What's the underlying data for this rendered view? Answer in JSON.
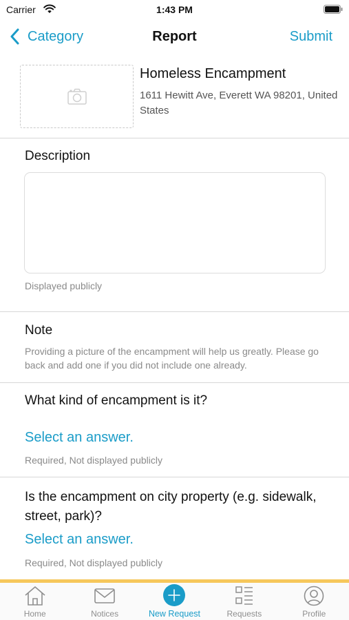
{
  "status_bar": {
    "carrier": "Carrier",
    "time": "1:43 PM",
    "icons": [
      "wifi-icon",
      "battery-icon"
    ]
  },
  "nav": {
    "back_label": "Category",
    "title": "Report",
    "submit_label": "Submit"
  },
  "report": {
    "photo_icon": "camera-icon",
    "category": "Homeless Encampment",
    "address": "1611 Hewitt Ave, Everett WA 98201, United States"
  },
  "description": {
    "label": "Description",
    "value": "",
    "hint": "Displayed publicly"
  },
  "note": {
    "label": "Note",
    "text": "Providing a picture of the encampment will help us greatly. Please go back and add one if you did not include one already."
  },
  "questions": [
    {
      "label": "What kind of encampment is it?",
      "answer": "Select an answer.",
      "hint": "Required, Not displayed publicly"
    },
    {
      "label": "Is the encampment on city property (e.g. sidewalk, street, park)?",
      "answer": "Select an answer.",
      "hint": "Required, Not displayed publicly"
    }
  ],
  "tabs": [
    {
      "label": "Home",
      "icon": "home-icon"
    },
    {
      "label": "Notices",
      "icon": "mail-icon"
    },
    {
      "label": "New Request",
      "icon": "plus-circle-icon",
      "active": true
    },
    {
      "label": "Requests",
      "icon": "list-icon"
    },
    {
      "label": "Profile",
      "icon": "person-circle-icon"
    }
  ],
  "colors": {
    "accent": "#1a9cc8",
    "tab_highlight": "#f6c75b",
    "hint_text": "#8a8a8a"
  }
}
